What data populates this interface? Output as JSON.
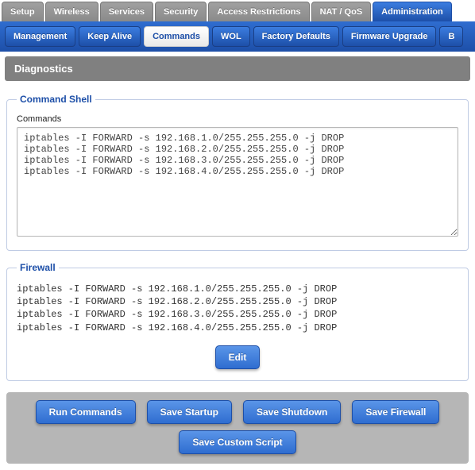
{
  "top_tabs": {
    "setup": "Setup",
    "wireless": "Wireless",
    "services": "Services",
    "security": "Security",
    "access_restrictions": "Access Restrictions",
    "nat_qos": "NAT / QoS",
    "administration": "Administration"
  },
  "sub_tabs": {
    "management": "Management",
    "keep_alive": "Keep Alive",
    "commands": "Commands",
    "wol": "WOL",
    "factory_defaults": "Factory Defaults",
    "firmware_upgrade": "Firmware Upgrade",
    "extra": "B"
  },
  "page_title": "Diagnostics",
  "command_shell": {
    "legend": "Command Shell",
    "label": "Commands",
    "value": "iptables -I FORWARD -s 192.168.1.0/255.255.255.0 -j DROP\niptables -I FORWARD -s 192.168.2.0/255.255.255.0 -j DROP\niptables -I FORWARD -s 192.168.3.0/255.255.255.0 -j DROP\niptables -I FORWARD -s 192.168.4.0/255.255.255.0 -j DROP"
  },
  "firewall": {
    "legend": "Firewall",
    "script": "iptables -I FORWARD -s 192.168.1.0/255.255.255.0 -j DROP\niptables -I FORWARD -s 192.168.2.0/255.255.255.0 -j DROP\niptables -I FORWARD -s 192.168.3.0/255.255.255.0 -j DROP\niptables -I FORWARD -s 192.168.4.0/255.255.255.0 -j DROP",
    "edit_label": "Edit"
  },
  "actions": {
    "run_commands": "Run Commands",
    "save_startup": "Save Startup",
    "save_shutdown": "Save Shutdown",
    "save_firewall": "Save Firewall",
    "save_custom_script": "Save Custom Script"
  }
}
